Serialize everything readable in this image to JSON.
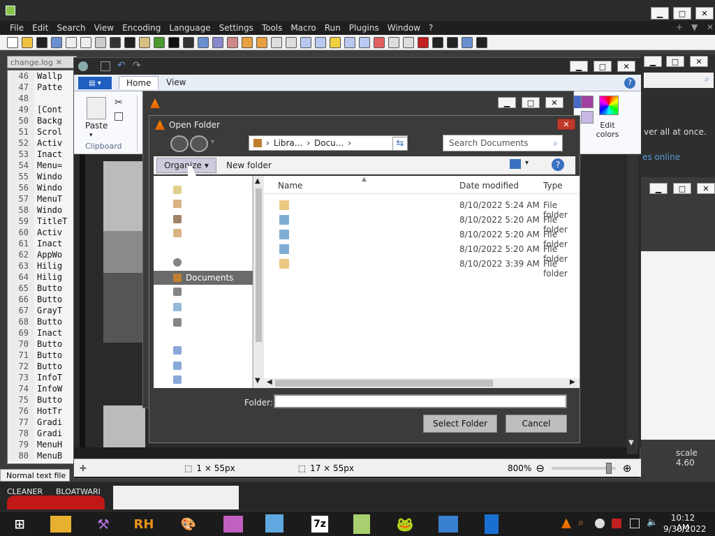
{
  "npp": {
    "menu": [
      "File",
      "Edit",
      "Search",
      "View",
      "Encoding",
      "Language",
      "Settings",
      "Tools",
      "Macro",
      "Run",
      "Plugins",
      "Window",
      "?"
    ],
    "menu_right": [
      "+",
      "▼",
      "✕"
    ],
    "tab_label": "change.log",
    "lines": [
      {
        "n": "46",
        "t": "Wallp"
      },
      {
        "n": "47",
        "t": "Patte"
      },
      {
        "n": "48",
        "t": ""
      },
      {
        "n": "49",
        "t": "[Cont"
      },
      {
        "n": "50",
        "t": "Backg"
      },
      {
        "n": "51",
        "t": "Scrol"
      },
      {
        "n": "52",
        "t": "Activ"
      },
      {
        "n": "53",
        "t": "Inact"
      },
      {
        "n": "54",
        "t": "Menu="
      },
      {
        "n": "55",
        "t": "Windo"
      },
      {
        "n": "56",
        "t": "Windo"
      },
      {
        "n": "57",
        "t": "MenuT"
      },
      {
        "n": "58",
        "t": "Windo"
      },
      {
        "n": "59",
        "t": "TitleT"
      },
      {
        "n": "60",
        "t": "Activ"
      },
      {
        "n": "61",
        "t": "Inact"
      },
      {
        "n": "62",
        "t": "AppWo"
      },
      {
        "n": "63",
        "t": "Hilig"
      },
      {
        "n": "64",
        "t": "Hilig"
      },
      {
        "n": "65",
        "t": "Butto"
      },
      {
        "n": "66",
        "t": "Butto"
      },
      {
        "n": "67",
        "t": "GrayT"
      },
      {
        "n": "68",
        "t": "Butto"
      },
      {
        "n": "69",
        "t": "Inact"
      },
      {
        "n": "70",
        "t": "Butto"
      },
      {
        "n": "71",
        "t": "Butto"
      },
      {
        "n": "72",
        "t": "Butto"
      },
      {
        "n": "73",
        "t": "InfoT"
      },
      {
        "n": "74",
        "t": "InfoW"
      },
      {
        "n": "75",
        "t": "Butto"
      },
      {
        "n": "76",
        "t": "HotTr"
      },
      {
        "n": "77",
        "t": "Gradi"
      },
      {
        "n": "78",
        "t": "Gradi"
      },
      {
        "n": "79",
        "t": "MenuH"
      },
      {
        "n": "80",
        "t": "MenuB"
      }
    ],
    "status": "Normal text file"
  },
  "paint": {
    "tabs": {
      "home": "Home",
      "view": "View"
    },
    "paste": "Paste",
    "clipboard": "Clipboard",
    "edit_colors": "Edit colors",
    "status": {
      "size1": "1 × 55px",
      "size2": "17 × 55px",
      "zoom": "800%",
      "plus": "⊕",
      "minus": "⊖"
    }
  },
  "dialog": {
    "title": "Open Folder",
    "close": "✕",
    "address": [
      "Libra...",
      "Docu..."
    ],
    "search_placeholder": "Search Documents",
    "organize": "Organize",
    "new_folder": "New folder",
    "help": "?",
    "nav": {
      "selected": "Documents"
    },
    "columns": {
      "name": "Name",
      "date": "Date modified",
      "type": "Type"
    },
    "rows": [
      {
        "date": "8/10/2022 5:24 AM",
        "type": "File folder"
      },
      {
        "date": "8/10/2022 5:20 AM",
        "type": "File folder"
      },
      {
        "date": "8/10/2022 5:20 AM",
        "type": "File folder"
      },
      {
        "date": "8/10/2022 5:20 AM",
        "type": "File folder"
      },
      {
        "date": "8/10/2022 3:39 AM",
        "type": "File folder"
      }
    ],
    "folder_label": "Folder:",
    "folder_value": "",
    "select": "Select Folder",
    "cancel": "Cancel"
  },
  "right": {
    "text1": "ver all at once.",
    "text2": "es online",
    "scale": "scale 4.60"
  },
  "strip": {
    "a": "CLEANER",
    "b": "BLOATWARI"
  },
  "taskbar": {
    "time": "10:12 AM",
    "date": "9/30/2022",
    "rh": "RH",
    "sevenzip": "7z"
  },
  "colors": {
    "accent": "#1f5fbf",
    "close": "#c0392b"
  }
}
